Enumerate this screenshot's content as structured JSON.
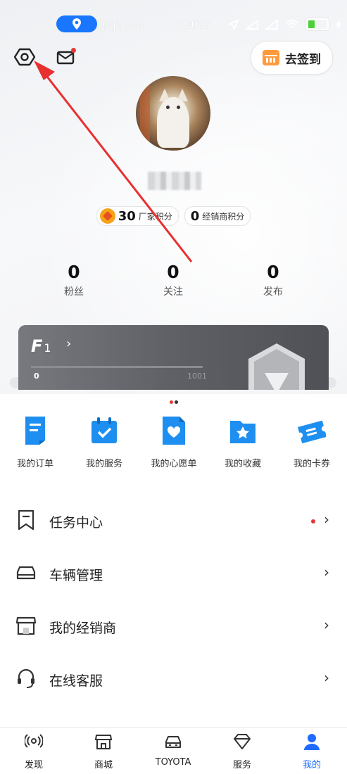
{
  "status_bar": {
    "time": "下午1:34",
    "net_speed": "4.9K/s"
  },
  "header": {
    "signin_label": "去签到"
  },
  "profile": {
    "points": [
      {
        "value": "30",
        "label": "厂家积分"
      },
      {
        "value": "0",
        "label": "经销商积分"
      }
    ],
    "stats": [
      {
        "value": "0",
        "label": "粉丝"
      },
      {
        "value": "0",
        "label": "关注"
      },
      {
        "value": "0",
        "label": "发布"
      }
    ]
  },
  "member_card": {
    "level": "1",
    "progress_min": "0",
    "progress_max": "1001"
  },
  "quick_actions": [
    {
      "label": "我的订单",
      "icon": "order-icon"
    },
    {
      "label": "我的服务",
      "icon": "service-calendar-icon"
    },
    {
      "label": "我的心愿单",
      "icon": "wishlist-heart-icon"
    },
    {
      "label": "我的收藏",
      "icon": "favorites-star-icon"
    },
    {
      "label": "我的卡券",
      "icon": "coupon-ticket-icon"
    }
  ],
  "menu": [
    {
      "label": "任务中心",
      "icon": "task-bookmark-icon",
      "badge_dot": true
    },
    {
      "label": "车辆管理",
      "icon": "car-icon",
      "badge_dot": false
    },
    {
      "label": "我的经销商",
      "icon": "store-icon",
      "badge_dot": false
    },
    {
      "label": "在线客服",
      "icon": "headset-icon",
      "badge_dot": false
    }
  ],
  "bottom_nav": [
    {
      "label": "发现",
      "icon": "discover-icon"
    },
    {
      "label": "商城",
      "icon": "mall-icon"
    },
    {
      "label": "TOYOTA",
      "icon": "car-front-icon"
    },
    {
      "label": "服务",
      "icon": "diamond-icon"
    },
    {
      "label": "我的",
      "icon": "profile-icon",
      "active": true
    }
  ],
  "colors": {
    "accent": "#1f6bff",
    "icon_blue": "#1e8ff0",
    "red_dot": "#e53935",
    "annotation_red": "#e8302f"
  }
}
